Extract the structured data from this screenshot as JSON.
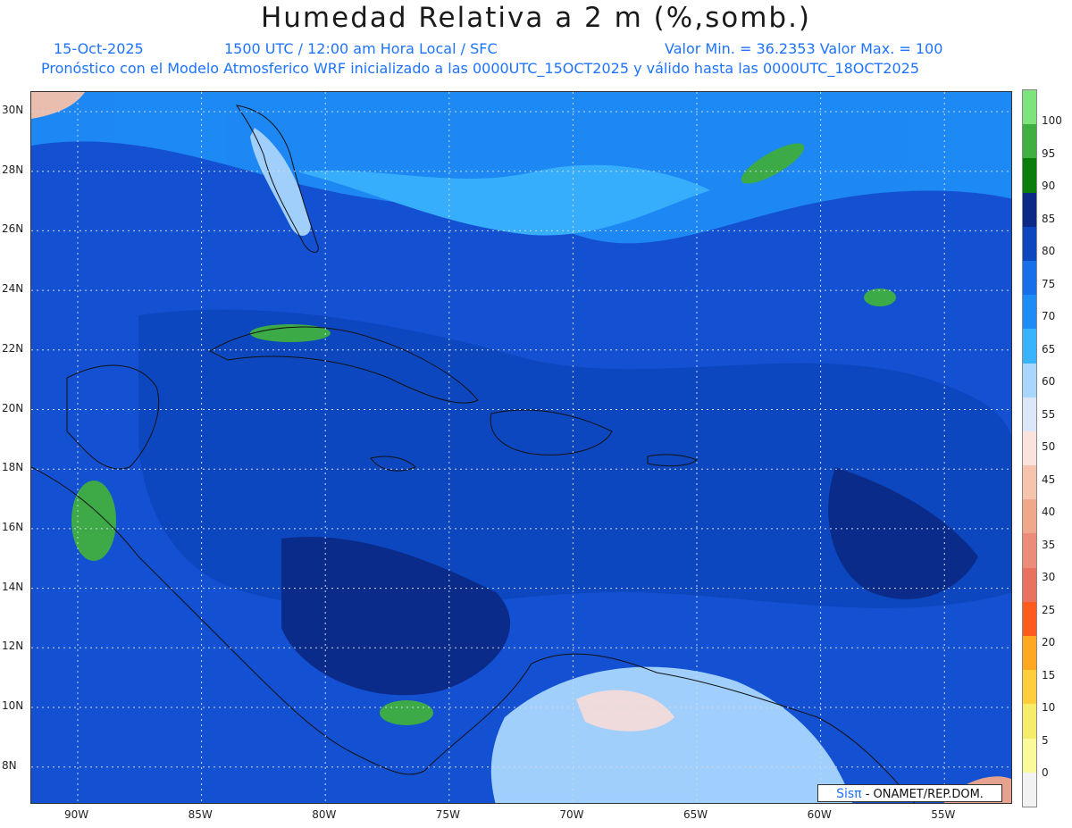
{
  "header": {
    "title": "Humedad Relativa a 2 m (%,somb.)",
    "date": "15-Oct-2025",
    "time_info": "1500 UTC / 12:00 am Hora Local / SFC",
    "min_max": "Valor Min. = 36.2353  Valor Max. = 100",
    "model_info": "Pronóstico con el Modelo Atmosferico WRF inicializado a las 0000UTC_15OCT2025 y válido hasta las  0000UTC_18OCT2025"
  },
  "map": {
    "lat_labels": [
      "30N",
      "28N",
      "26N",
      "24N",
      "22N",
      "20N",
      "18N",
      "16N",
      "14N",
      "12N",
      "10N",
      "8N"
    ],
    "lon_labels": [
      "90W",
      "85W",
      "80W",
      "75W",
      "70W",
      "65W",
      "60W",
      "55W"
    ],
    "gridlines": true,
    "background_color": "#1450d2"
  },
  "credit": {
    "brand": "Sisπ",
    "text": "- ONAMET/REP.DOM."
  },
  "colorbar": {
    "labels": [
      "100",
      "95",
      "90",
      "85",
      "80",
      "75",
      "70",
      "65",
      "60",
      "55",
      "50",
      "45",
      "40",
      "35",
      "30",
      "25",
      "20",
      "15",
      "10",
      "5",
      "0"
    ],
    "colors": [
      "#7de47d",
      "#3faf3f",
      "#0a7d0a",
      "#0a2a86",
      "#0d47bf",
      "#1670ea",
      "#1e8cf5",
      "#38b4ff",
      "#a8d6ff",
      "#dce8fa",
      "#fbe3dd",
      "#f6c4ad",
      "#f0a88b",
      "#ec8c78",
      "#e9715f",
      "#ff5b1e",
      "#ffa71f",
      "#ffce3a",
      "#f4ec6a",
      "#fafa9a",
      "#f2f2f2"
    ]
  }
}
